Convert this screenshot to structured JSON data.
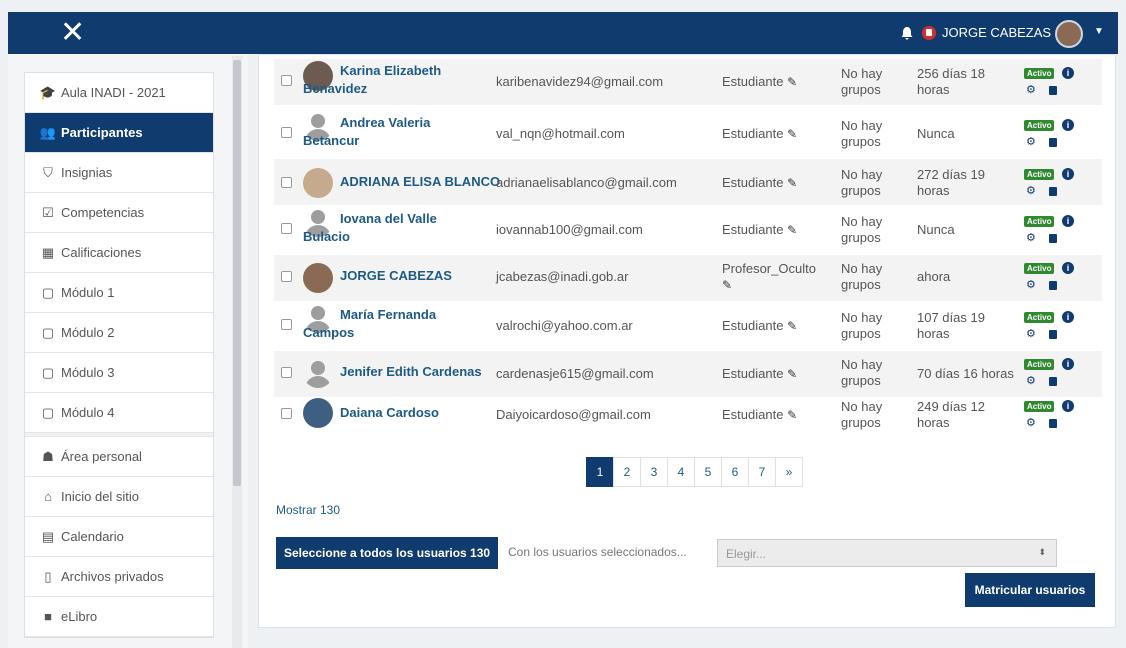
{
  "header": {
    "close_icon": "✕",
    "user_name": "JORGE CABEZAS"
  },
  "nav": {
    "items": [
      {
        "label": "Aula INADI - 2021",
        "icon": "🎓"
      },
      {
        "label": "Participantes",
        "icon": "👥"
      },
      {
        "label": "Insignias",
        "icon": "⛉"
      },
      {
        "label": "Competencias",
        "icon": "☑"
      },
      {
        "label": "Calificaciones",
        "icon": "▦"
      },
      {
        "label": "Módulo 1",
        "icon": "▢"
      },
      {
        "label": "Módulo 2",
        "icon": "▢"
      },
      {
        "label": "Módulo 3",
        "icon": "▢"
      },
      {
        "label": "Módulo 4",
        "icon": "▢"
      },
      {
        "label": "Área personal",
        "icon": "☗"
      },
      {
        "label": "Inicio del sitio",
        "icon": "⌂"
      },
      {
        "label": "Calendario",
        "icon": "▤"
      },
      {
        "label": "Archivos privados",
        "icon": "▯"
      },
      {
        "label": "eLibro",
        "icon": "■"
      }
    ]
  },
  "participants": {
    "rows": [
      {
        "name": "Karina Elizabeth Benavidez",
        "email": "karibenavidez94@gmail.com",
        "role": "Estudiante",
        "groups": "No hay grupos",
        "last_access": "256 días 18 horas",
        "status": "Activo"
      },
      {
        "name": "Andrea Valeria Betancur",
        "email": "val_nqn@hotmail.com",
        "role": "Estudiante",
        "groups": "No hay grupos",
        "last_access": "Nunca",
        "status": "Activo"
      },
      {
        "name": "ADRIANA ELISA BLANCO",
        "email": "adrianaelisablanco@gmail.com",
        "role": "Estudiante",
        "groups": "No hay grupos",
        "last_access": "272 días 19 horas",
        "status": "Activo"
      },
      {
        "name": "Iovana del Valle Bulacio",
        "email": "iovannab100@gmail.com",
        "role": "Estudiante",
        "groups": "No hay grupos",
        "last_access": "Nunca",
        "status": "Activo"
      },
      {
        "name": "JORGE CABEZAS",
        "email": "jcabezas@inadi.gob.ar",
        "role": "Profesor_Oculto",
        "groups": "No hay grupos",
        "last_access": "ahora",
        "status": "Activo"
      },
      {
        "name": "María Fernanda Campos",
        "email": "valrochi@yahoo.com.ar",
        "role": "Estudiante",
        "groups": "No hay grupos",
        "last_access": "107 días 19 horas",
        "status": "Activo"
      },
      {
        "name": "Jenifer Edith Cardenas",
        "email": "cardenasje615@gmail.com",
        "role": "Estudiante",
        "groups": "No hay grupos",
        "last_access": "70 días 16 horas",
        "status": "Activo"
      },
      {
        "name": "Daiana Cardoso",
        "email": "Daiyoicardoso@gmail.com",
        "role": "Estudiante",
        "groups": "No hay grupos",
        "last_access": "249 días 12 horas",
        "status": "Activo"
      }
    ]
  },
  "pagination": {
    "pages": [
      "1",
      "2",
      "3",
      "4",
      "5",
      "6",
      "7",
      "»"
    ]
  },
  "footer": {
    "show_all": "Mostrar 130",
    "select_all": "Seleccione a todos los usuarios 130",
    "with_selected": "Con los usuarios seleccionados...",
    "choose_placeholder": "Elegir...",
    "enrol_button": "Matricular usuarios"
  }
}
